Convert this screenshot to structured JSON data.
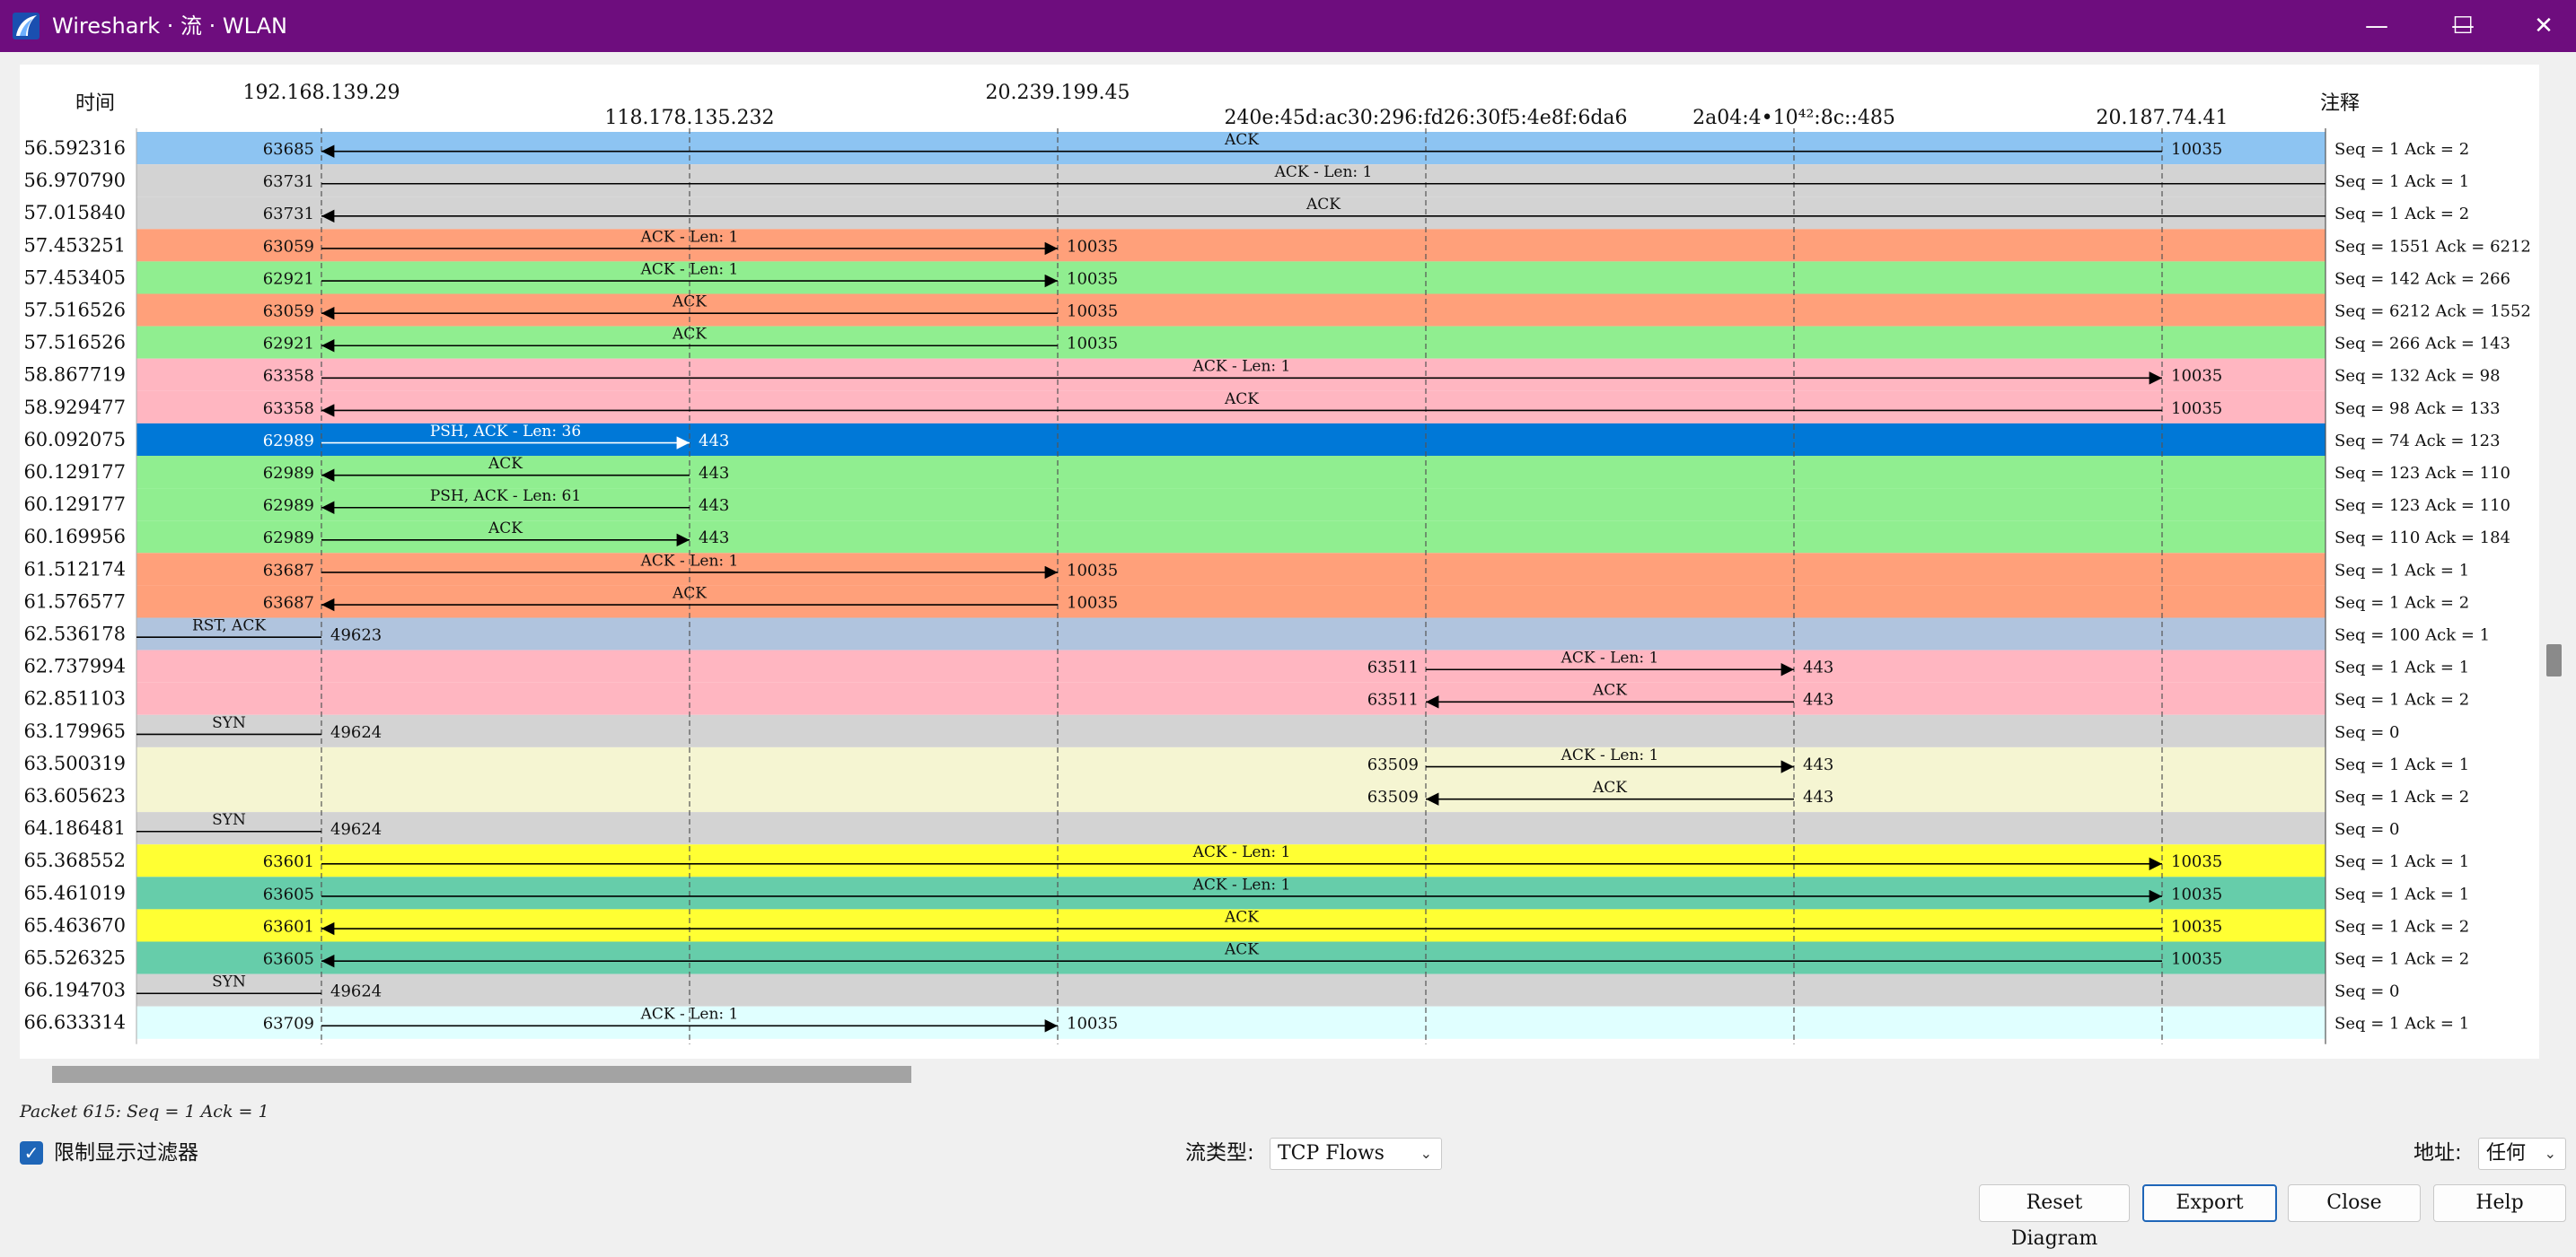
{
  "window": {
    "title": "Wireshark · 流 · WLAN",
    "minimize_glyph": "—",
    "maximize_glyph": "☐",
    "close_glyph": "✕",
    "icon": "wireshark-fin-icon"
  },
  "diagram": {
    "time_header": "时间",
    "comment_header": "注释",
    "hosts": [
      "192.168.139.29",
      "118.178.135.232",
      "20.239.199.45",
      "240e:45d:ac30:296:fd26:30f5:4e8f:6da6",
      "2a04:4•10⁴²:8c::485",
      "20.187.74.41"
    ],
    "colors": {
      "blue": "#8dc4f2",
      "gray": "#d3d3d3",
      "salmon": "#ffa07a",
      "green": "#90ee90",
      "pink": "#ffb6c1",
      "selected": "#0078d7",
      "steel": "#b0c4de",
      "cream": "#f5f5d2",
      "yellow": "#ffff33",
      "teal": "#66cdaa",
      "cyan": "#e0ffff"
    },
    "rows": [
      {
        "time": "56.592316",
        "color": "blue",
        "from": 5,
        "to": 0,
        "label": "ACK",
        "src_port": "10035",
        "dst_port": "63685",
        "comment": "Seq = 1 Ack = 2"
      },
      {
        "time": "56.970790",
        "color": "gray",
        "from": 0,
        "to": 6,
        "label": "ACK - Len: 1",
        "src_port": "63731",
        "dst_port": "",
        "comment": "Seq = 1 Ack = 1"
      },
      {
        "time": "57.015840",
        "color": "gray",
        "from": 6,
        "to": 0,
        "label": "ACK",
        "src_port": "",
        "dst_port": "63731",
        "comment": "Seq = 1 Ack = 2"
      },
      {
        "time": "57.453251",
        "color": "salmon",
        "from": 0,
        "to": 2,
        "label": "ACK - Len: 1",
        "src_port": "63059",
        "dst_port": "10035",
        "comment": "Seq = 1551 Ack = 6212"
      },
      {
        "time": "57.453405",
        "color": "green",
        "from": 0,
        "to": 2,
        "label": "ACK - Len: 1",
        "src_port": "62921",
        "dst_port": "10035",
        "comment": "Seq = 142 Ack = 266"
      },
      {
        "time": "57.516526",
        "color": "salmon",
        "from": 2,
        "to": 0,
        "label": "ACK",
        "src_port": "10035",
        "dst_port": "63059",
        "comment": "Seq = 6212 Ack = 1552"
      },
      {
        "time": "57.516526",
        "color": "green",
        "from": 2,
        "to": 0,
        "label": "ACK",
        "src_port": "10035",
        "dst_port": "62921",
        "comment": "Seq = 266 Ack = 143"
      },
      {
        "time": "58.867719",
        "color": "pink",
        "from": 0,
        "to": 5,
        "label": "ACK - Len: 1",
        "src_port": "63358",
        "dst_port": "10035",
        "comment": "Seq = 132 Ack = 98"
      },
      {
        "time": "58.929477",
        "color": "pink",
        "from": 5,
        "to": 0,
        "label": "ACK",
        "src_port": "10035",
        "dst_port": "63358",
        "comment": "Seq = 98 Ack = 133"
      },
      {
        "time": "60.092075",
        "color": "selected",
        "from": 0,
        "to": 1,
        "label": "PSH, ACK - Len: 36",
        "src_port": "62989",
        "dst_port": "443",
        "comment": "Seq = 74 Ack = 123"
      },
      {
        "time": "60.129177",
        "color": "green",
        "from": 1,
        "to": 0,
        "label": "ACK",
        "src_port": "443",
        "dst_port": "62989",
        "comment": "Seq = 123 Ack = 110"
      },
      {
        "time": "60.129177",
        "color": "green",
        "from": 1,
        "to": 0,
        "label": "PSH, ACK - Len: 61",
        "src_port": "443",
        "dst_port": "62989",
        "comment": "Seq = 123 Ack = 110"
      },
      {
        "time": "60.169956",
        "color": "green",
        "from": 0,
        "to": 1,
        "label": "ACK",
        "src_port": "62989",
        "dst_port": "443",
        "comment": "Seq = 110 Ack = 184"
      },
      {
        "time": "61.512174",
        "color": "salmon",
        "from": 0,
        "to": 2,
        "label": "ACK - Len: 1",
        "src_port": "63687",
        "dst_port": "10035",
        "comment": "Seq = 1 Ack = 1"
      },
      {
        "time": "61.576577",
        "color": "salmon",
        "from": 2,
        "to": 0,
        "label": "ACK",
        "src_port": "10035",
        "dst_port": "63687",
        "comment": "Seq = 1 Ack = 2"
      },
      {
        "time": "62.536178",
        "color": "steel",
        "from": 0,
        "to": 7,
        "label": "RST, ACK",
        "src_port": "49623",
        "dst_port": "",
        "comment": "Seq = 100 Ack = 1"
      },
      {
        "time": "62.737994",
        "color": "pink",
        "from": 3,
        "to": 4,
        "label": "ACK - Len: 1",
        "src_port": "63511",
        "dst_port": "443",
        "comment": "Seq = 1 Ack = 1"
      },
      {
        "time": "62.851103",
        "color": "pink",
        "from": 4,
        "to": 3,
        "label": "ACK",
        "src_port": "443",
        "dst_port": "63511",
        "comment": "Seq = 1 Ack = 2"
      },
      {
        "time": "63.179965",
        "color": "gray",
        "from": 0,
        "to": 7,
        "label": "SYN",
        "src_port": "49624",
        "dst_port": "",
        "comment": "Seq = 0"
      },
      {
        "time": "63.500319",
        "color": "cream",
        "from": 3,
        "to": 4,
        "label": "ACK - Len: 1",
        "src_port": "63509",
        "dst_port": "443",
        "comment": "Seq = 1 Ack = 1"
      },
      {
        "time": "63.605623",
        "color": "cream",
        "from": 4,
        "to": 3,
        "label": "ACK",
        "src_port": "443",
        "dst_port": "63509",
        "comment": "Seq = 1 Ack = 2"
      },
      {
        "time": "64.186481",
        "color": "gray",
        "from": 0,
        "to": 7,
        "label": "SYN",
        "src_port": "49624",
        "dst_port": "",
        "comment": "Seq = 0"
      },
      {
        "time": "65.368552",
        "color": "yellow",
        "from": 0,
        "to": 5,
        "label": "ACK - Len: 1",
        "src_port": "63601",
        "dst_port": "10035",
        "comment": "Seq = 1 Ack = 1"
      },
      {
        "time": "65.461019",
        "color": "teal",
        "from": 0,
        "to": 5,
        "label": "ACK - Len: 1",
        "src_port": "63605",
        "dst_port": "10035",
        "comment": "Seq = 1 Ack = 1"
      },
      {
        "time": "65.463670",
        "color": "yellow",
        "from": 5,
        "to": 0,
        "label": "ACK",
        "src_port": "10035",
        "dst_port": "63601",
        "comment": "Seq = 1 Ack = 2"
      },
      {
        "time": "65.526325",
        "color": "teal",
        "from": 5,
        "to": 0,
        "label": "ACK",
        "src_port": "10035",
        "dst_port": "63605",
        "comment": "Seq = 1 Ack = 2"
      },
      {
        "time": "66.194703",
        "color": "gray",
        "from": 0,
        "to": 7,
        "label": "SYN",
        "src_port": "49624",
        "dst_port": "",
        "comment": "Seq = 0"
      },
      {
        "time": "66.633314",
        "color": "cyan",
        "from": 0,
        "to": 2,
        "label": "ACK - Len: 1",
        "src_port": "63709",
        "dst_port": "10035",
        "comment": "Seq = 1 Ack = 1"
      }
    ]
  },
  "status": {
    "packet_info": "Packet 615: Seq = 1 Ack = 1"
  },
  "controls": {
    "filter_checkbox_glyph": "✓",
    "filter_label": "限制显示过滤器",
    "flow_type_label": "流类型:",
    "flow_type_value": "TCP Flows",
    "address_label": "地址:",
    "address_value": "任何",
    "chevron_glyph": "⌄"
  },
  "buttons": {
    "reset": "Reset Diagram",
    "export": "Export",
    "close": "Close",
    "help": "Help"
  }
}
